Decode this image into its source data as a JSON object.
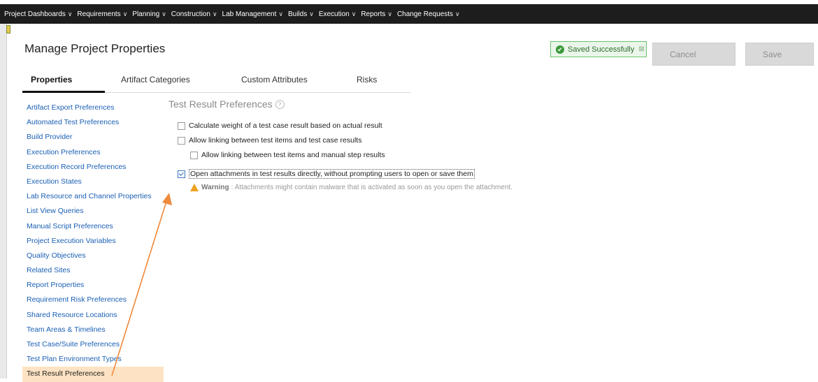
{
  "nav": {
    "items": [
      {
        "label": "Project Dashboards"
      },
      {
        "label": "Requirements"
      },
      {
        "label": "Planning"
      },
      {
        "label": "Construction"
      },
      {
        "label": "Lab Management"
      },
      {
        "label": "Builds"
      },
      {
        "label": "Execution"
      },
      {
        "label": "Reports"
      },
      {
        "label": "Change Requests"
      }
    ],
    "chevron": "∨"
  },
  "header": {
    "title": "Manage Project Properties",
    "status": "Saved Successfully",
    "cancel_label": "Cancel",
    "save_label": "Save"
  },
  "tabs": [
    {
      "label": "Properties",
      "active": true
    },
    {
      "label": "Artifact Categories"
    },
    {
      "label": "Custom Attributes"
    },
    {
      "label": "Risks"
    }
  ],
  "sidebar": {
    "items": [
      {
        "label": "Artifact Export Preferences"
      },
      {
        "label": "Automated Test Preferences"
      },
      {
        "label": "Build Provider"
      },
      {
        "label": "Execution Preferences"
      },
      {
        "label": "Execution Record Preferences"
      },
      {
        "label": "Execution States"
      },
      {
        "label": "Lab Resource and Channel Properties"
      },
      {
        "label": "List View Queries"
      },
      {
        "label": "Manual Script Preferences"
      },
      {
        "label": "Project Execution Variables"
      },
      {
        "label": "Quality Objectives"
      },
      {
        "label": "Related Sites"
      },
      {
        "label": "Report Properties"
      },
      {
        "label": "Requirement Risk Preferences"
      },
      {
        "label": "Shared Resource Locations"
      },
      {
        "label": "Team Areas & Timelines"
      },
      {
        "label": "Test Case/Suite Preferences"
      },
      {
        "label": "Test Plan Environment Types"
      },
      {
        "label": "Test Result Preferences",
        "selected": true
      }
    ]
  },
  "main": {
    "section_title": "Test Result Preferences",
    "help_glyph": "?",
    "options": [
      {
        "label": "Calculate weight of a test case result based on actual result",
        "checked": false
      },
      {
        "label": "Allow linking between test items and test case results",
        "checked": false
      },
      {
        "label": "Allow linking between test items and manual step results",
        "checked": false
      },
      {
        "label": "Open attachments in test results directly, without prompting users to open or save them",
        "checked": true
      }
    ],
    "warning": {
      "prefix": "Warning",
      "text": ": Attachments might contain malware that is activated as soon as you open the attachment."
    }
  },
  "colors": {
    "accent_link": "#1a5fb4",
    "selected_bg": "#fde3c3",
    "annotation_arrow": "#f08a3c",
    "success": "#3c9a3c"
  }
}
